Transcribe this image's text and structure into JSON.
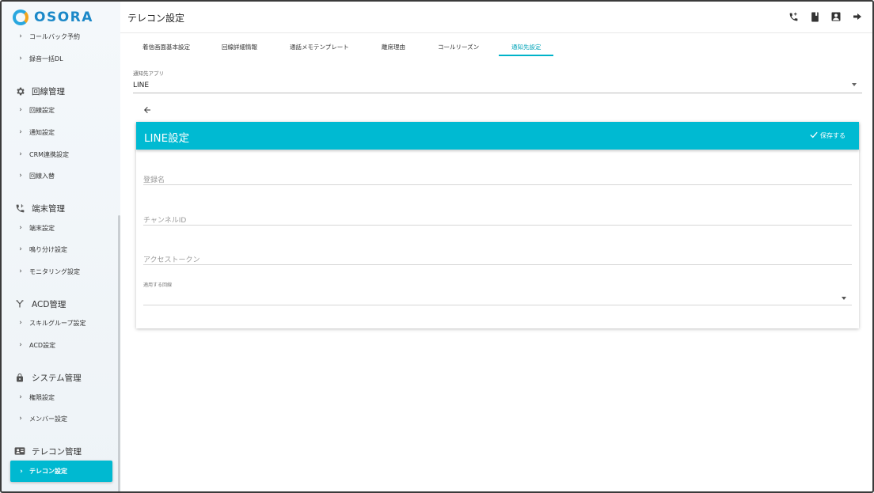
{
  "app": {
    "logo_text": "OSORA"
  },
  "sidebar": {
    "items_top": [
      {
        "label": "コールバック予約"
      },
      {
        "label": "録音一括DL"
      }
    ],
    "sections": [
      {
        "title": "回線管理",
        "icon": "gear-icon",
        "items": [
          "回線設定",
          "通知設定",
          "CRM連携設定",
          "回線入替"
        ]
      },
      {
        "title": "端末管理",
        "icon": "phone-forward-icon",
        "items": [
          "端末設定",
          "鳴り分け設定",
          "モニタリング設定"
        ]
      },
      {
        "title": "ACD管理",
        "icon": "call-split-icon",
        "items": [
          "スキルグループ設定",
          "ACD設定"
        ]
      },
      {
        "title": "システム管理",
        "icon": "lock-icon",
        "items": [
          "権限設定",
          "メンバー設定"
        ]
      },
      {
        "title": "テレコン管理",
        "icon": "contact-card-icon",
        "items": [
          "テレコン設定"
        ]
      }
    ],
    "active_item": "テレコン設定"
  },
  "header": {
    "title": "テレコン設定",
    "icons": [
      "phone-forward-icon",
      "book-icon",
      "account-box-icon",
      "logout-icon"
    ]
  },
  "tabs": [
    {
      "label": "着信画面基本設定",
      "active": false
    },
    {
      "label": "回線詳細情報",
      "active": false
    },
    {
      "label": "通話メモテンプレート",
      "active": false
    },
    {
      "label": "離席理由",
      "active": false
    },
    {
      "label": "コールリーズン",
      "active": false
    },
    {
      "label": "通知先設定",
      "active": true
    }
  ],
  "notify_app": {
    "label": "通知先アプリ",
    "value": "LINE"
  },
  "card": {
    "title": "LINE設定",
    "save_label": "保存する",
    "fields": {
      "name_placeholder": "登録名",
      "channel_placeholder": "チャンネルID",
      "token_placeholder": "アクセストークン",
      "lines_label": "適用する回線",
      "lines_value": ""
    }
  },
  "colors": {
    "accent": "#00bad2",
    "active_tab": "#00a3b8",
    "logo_blue": "#1b88c8",
    "logo_orange": "#f4a51c"
  }
}
